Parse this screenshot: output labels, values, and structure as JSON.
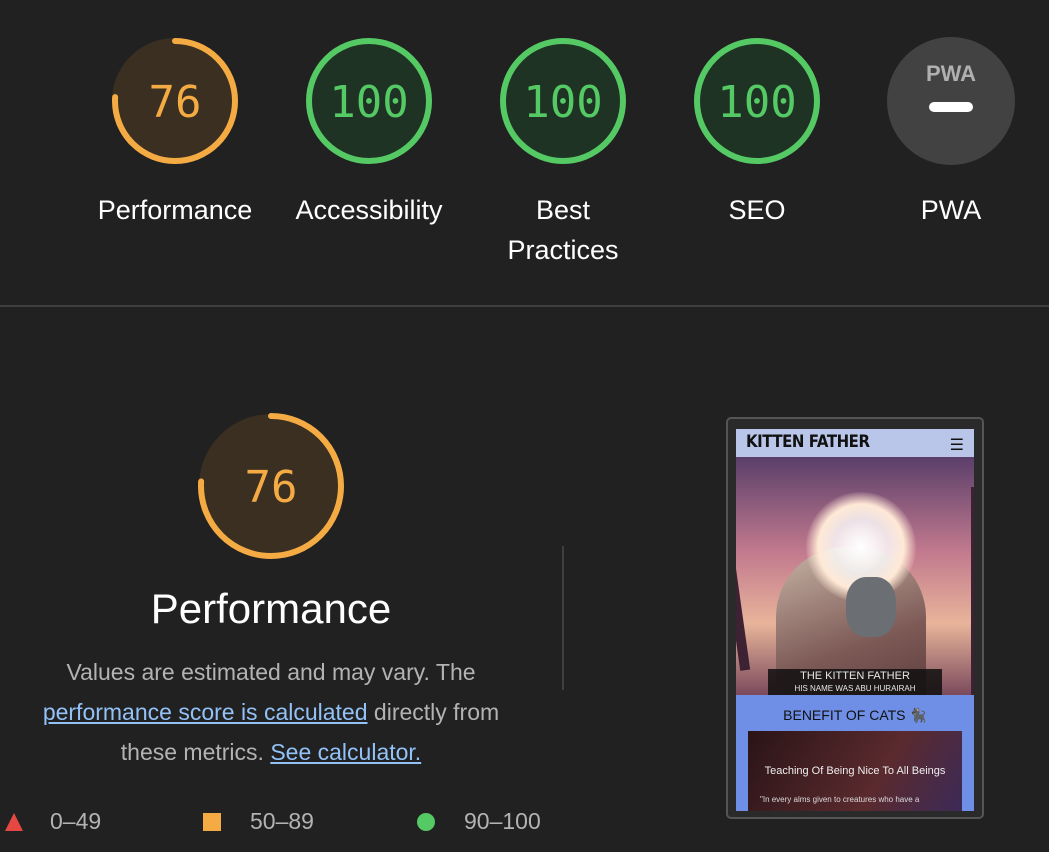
{
  "gauges": [
    {
      "label": "Performance",
      "score": "76",
      "value": 76,
      "status": "average"
    },
    {
      "label": "Accessibility",
      "score": "100",
      "value": 100,
      "status": "pass"
    },
    {
      "label": "Best Practices",
      "score": "100",
      "value": 100,
      "status": "pass"
    },
    {
      "label": "SEO",
      "score": "100",
      "value": 100,
      "status": "pass"
    },
    {
      "label": "PWA",
      "score": "",
      "value": null,
      "status": "na",
      "badge": "PWA"
    }
  ],
  "performance": {
    "score": "76",
    "title": "Performance",
    "desc_1": "Values are estimated and may vary. The",
    "link_1": "performance score is calculated",
    "desc_2": " directly from these metrics.",
    "link_2": "See calculator."
  },
  "legend": {
    "fail": "0–49",
    "average": "50–89",
    "pass": "90–100"
  },
  "screenshot": {
    "brand": "KITTEN FATHER",
    "menu_icon": "hamburger-icon",
    "hero_title": "THE KITTEN FATHER",
    "hero_subtitle": "HIS NAME WAS ABU HURAIRAH",
    "section_title": "BENEFIT OF CATS",
    "card_title": "Teaching Of Being Nice To All Beings",
    "card_text": "\"In every alms given to creatures who have a"
  },
  "colors": {
    "background": "#212121",
    "average": "#f5ab43",
    "pass": "#54c964",
    "fail": "#e54843",
    "link": "#92c2f7"
  }
}
